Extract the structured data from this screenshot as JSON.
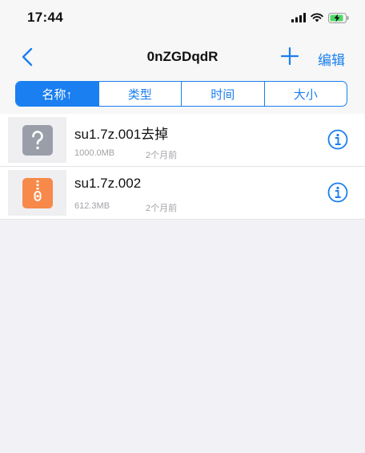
{
  "status_bar": {
    "time": "17:44"
  },
  "nav": {
    "title": "0nZGDqdR",
    "edit_label": "编辑"
  },
  "sort_tabs": [
    {
      "label": "名称↑",
      "active": true
    },
    {
      "label": "类型",
      "active": false
    },
    {
      "label": "时间",
      "active": false
    },
    {
      "label": "大小",
      "active": false
    }
  ],
  "files": [
    {
      "name": "su1.7z.001去掉",
      "size": "1000.0MB",
      "date": "2个月前",
      "icon": "unknown-file-icon"
    },
    {
      "name": "su1.7z.002",
      "size": "612.3MB",
      "date": "2个月前",
      "icon": "zip-file-icon"
    }
  ],
  "colors": {
    "accent": "#1a7ff0",
    "zip": "#f7894a",
    "unknown": "#9a9ea8"
  }
}
